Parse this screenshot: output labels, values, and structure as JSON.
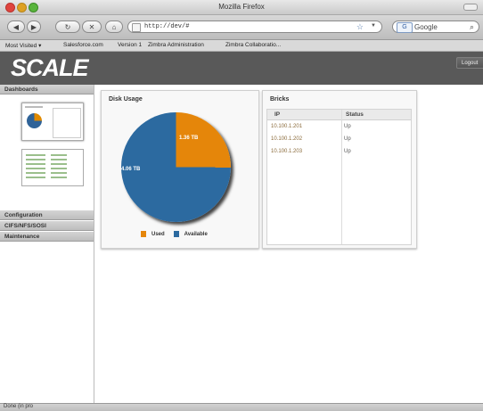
{
  "window": {
    "title": "Mozilla Firefox"
  },
  "toolbar": {
    "url": "http://dev/#",
    "search_engine_badge": "G",
    "search_placeholder": "Google"
  },
  "bookmarks": [
    "Most Visited ▾",
    "Salesforce.com",
    "Version 1",
    "Zimbra Administration",
    "Zimbra Collaboratio..."
  ],
  "app": {
    "logo": "SCALE",
    "logout_label": "Logout"
  },
  "sidebar": {
    "sections": [
      {
        "label": "Dashboards"
      },
      {
        "label": "Configuration"
      },
      {
        "label": "CIFS/NFS/SOSI"
      },
      {
        "label": "Maintenance"
      }
    ]
  },
  "disk_usage": {
    "title": "Disk Usage",
    "used_label": "1.36 TB",
    "available_label": "4.06 TB",
    "legend_used": "Used",
    "legend_available": "Available",
    "colors": {
      "used": "#e5860a",
      "available": "#2c6aa0"
    }
  },
  "chart_data": {
    "type": "pie",
    "title": "Disk Usage",
    "categories": [
      "Used",
      "Available"
    ],
    "values": [
      1.36,
      4.06
    ],
    "data_labels": [
      "1.36 TB",
      "4.06 TB"
    ],
    "legend": "bottom"
  },
  "bricks": {
    "title": "Bricks",
    "columns": [
      "IP",
      "Status"
    ],
    "rows": [
      {
        "ip": "10.100.1.201",
        "status": "Up"
      },
      {
        "ip": "10.100.1.202",
        "status": "Up"
      },
      {
        "ip": "10.100.1.203",
        "status": "Up"
      }
    ]
  },
  "status": {
    "text": "Done (in pro"
  }
}
